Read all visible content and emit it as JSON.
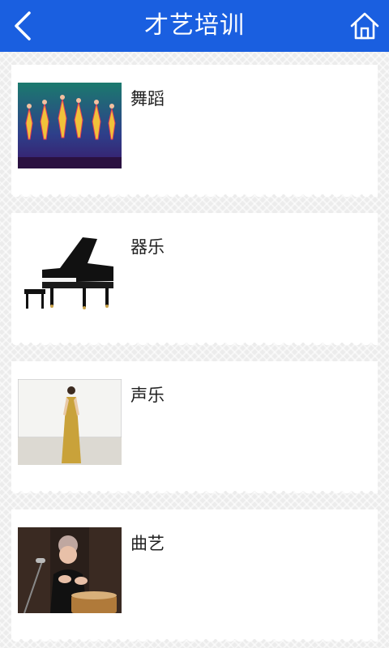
{
  "header": {
    "title": "才艺培训",
    "back_icon": "chevron-left-icon",
    "home_icon": "home-icon",
    "color": "#1a5fe0"
  },
  "items": [
    {
      "label": "舞蹈",
      "image": "dance-performance-photo"
    },
    {
      "label": "器乐",
      "image": "grand-piano-photo"
    },
    {
      "label": "声乐",
      "image": "singer-performance-photo"
    },
    {
      "label": "曲艺",
      "image": "folk-art-performer-photo"
    }
  ]
}
